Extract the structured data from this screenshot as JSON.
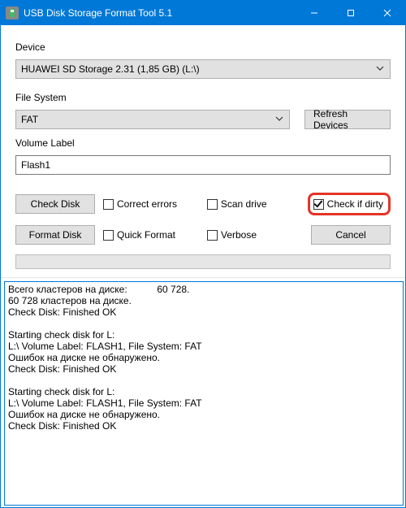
{
  "window": {
    "title": "USB Disk Storage Format Tool 5.1"
  },
  "labels": {
    "device": "Device",
    "file_system": "File System",
    "volume_label": "Volume Label"
  },
  "device": {
    "selected": "HUAWEI  SD Storage  2.31 (1,85 GB) (L:\\)"
  },
  "file_system": {
    "selected": "FAT"
  },
  "volume_label": {
    "value": "Flash1"
  },
  "buttons": {
    "refresh": "Refresh Devices",
    "check_disk": "Check Disk",
    "format_disk": "Format Disk",
    "cancel": "Cancel"
  },
  "checkboxes": {
    "correct_errors": {
      "label": "Correct errors",
      "checked": false
    },
    "scan_drive": {
      "label": "Scan drive",
      "checked": false
    },
    "check_if_dirty": {
      "label": "Check if dirty",
      "checked": true
    },
    "quick_format": {
      "label": "Quick Format",
      "checked": false
    },
    "verbose": {
      "label": "Verbose",
      "checked": false
    }
  },
  "highlight": "check_if_dirty",
  "log_text": "Всего кластеров на диске:           60 728.\n60 728 кластеров на диске.\nCheck Disk: Finished OK\n\nStarting check disk for L:\nL:\\ Volume Label: FLASH1, File System: FAT\nОшибок на диске не обнаружено.\nCheck Disk: Finished OK\n\nStarting check disk for L:\nL:\\ Volume Label: FLASH1, File System: FAT\nОшибок на диске не обнаружено.\nCheck Disk: Finished OK\n"
}
